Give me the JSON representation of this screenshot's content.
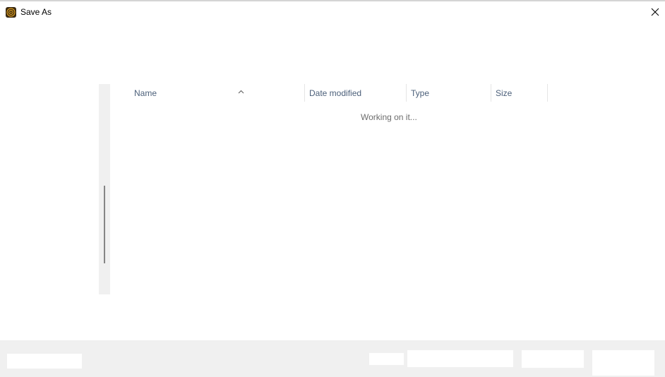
{
  "window": {
    "title": "Save As",
    "app_icon": "app-icon",
    "close_icon": "close-icon"
  },
  "file_list": {
    "columns": [
      {
        "label": "Name"
      },
      {
        "label": "Date modified"
      },
      {
        "label": "Type"
      },
      {
        "label": "Size"
      }
    ],
    "sort_icon": "sort-ascending-icon",
    "status": "Working on it..."
  }
}
